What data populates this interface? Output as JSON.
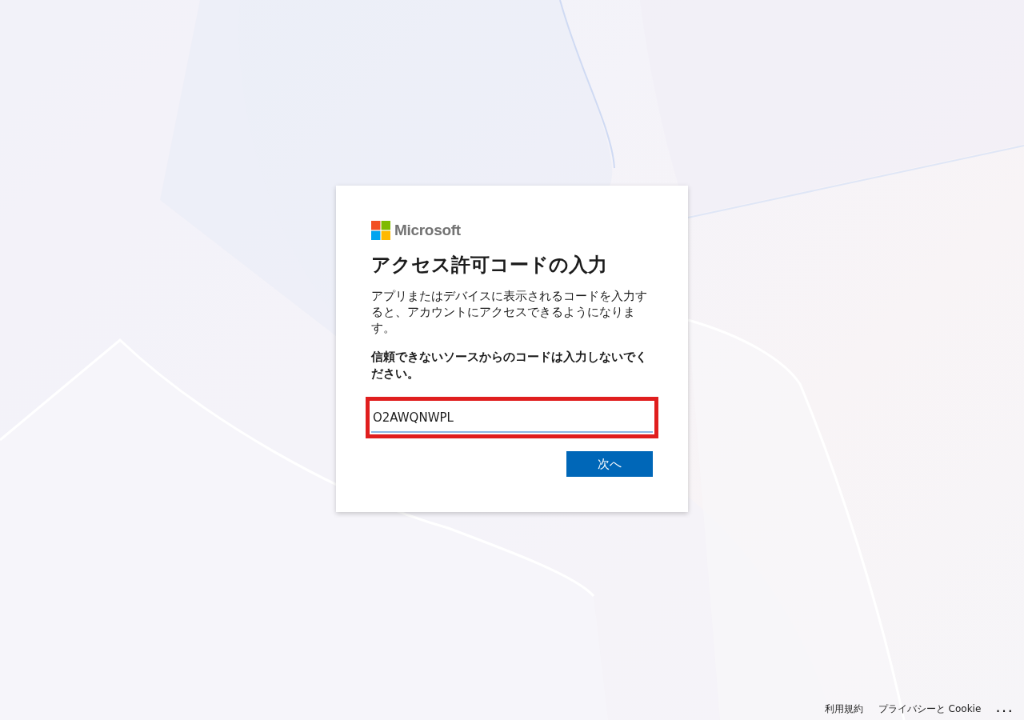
{
  "brand": {
    "name": "Microsoft"
  },
  "title": "アクセス許可コードの入力",
  "description": "アプリまたはデバイスに表示されるコードを入力すると、アカウントにアクセスできるようになります。",
  "warning": "信頼できないソースからのコードは入力しないでください。",
  "code_field": {
    "value": "O2AWQNWPL",
    "highlighted": true
  },
  "next_button": {
    "label": "次へ"
  },
  "footer": {
    "links": [
      "利用規約",
      "プライバシーと Cookie"
    ],
    "more": "..."
  }
}
